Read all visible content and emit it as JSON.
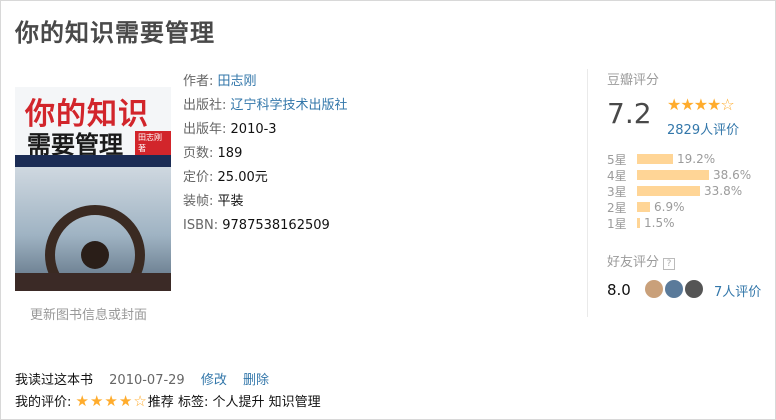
{
  "book": {
    "title": "你的知识需要管理",
    "cover": {
      "title_line1": "你的知识",
      "title_line2": "需要管理",
      "tag": "田志刚著",
      "update_link": "更新图书信息或封面"
    },
    "info": {
      "author_label": "作者:",
      "author": "田志刚",
      "publisher_label": "出版社:",
      "publisher": "辽宁科学技术出版社",
      "pubyear_label": "出版年:",
      "pubyear": "2010-3",
      "pages_label": "页数:",
      "pages": "189",
      "price_label": "定价:",
      "price": "25.00元",
      "binding_label": "装帧:",
      "binding": "平装",
      "isbn_label": "ISBN:",
      "isbn": "9787538162509"
    }
  },
  "rating": {
    "label": "豆瓣评分",
    "score": "7.2",
    "stars": "★★★★☆",
    "count": "2829人评价",
    "distribution": [
      {
        "label": "5星",
        "pct": "19.2%",
        "value": 19.2
      },
      {
        "label": "4星",
        "pct": "38.6%",
        "value": 38.6
      },
      {
        "label": "3星",
        "pct": "33.8%",
        "value": 33.8
      },
      {
        "label": "2星",
        "pct": "6.9%",
        "value": 6.9
      },
      {
        "label": "1星",
        "pct": "1.5%",
        "value": 1.5
      }
    ]
  },
  "friends": {
    "label": "好友评分",
    "help": "?",
    "score": "8.0",
    "count": "7人评价",
    "avatar_colors": [
      "#c9a07a",
      "#5a7a9a",
      "#555555"
    ]
  },
  "user": {
    "read_label": "我读过这本书",
    "read_date": "2010-07-29",
    "edit": "修改",
    "delete": "删除",
    "my_rating_label": "我的评价:",
    "my_stars": "★★★★☆",
    "recommend": "推荐",
    "tags_label": "标签:",
    "tags": "个人提升 知识管理"
  },
  "colors": {
    "link": "#3377aa",
    "star": "#ffac2d",
    "bar": "#ffd596"
  }
}
